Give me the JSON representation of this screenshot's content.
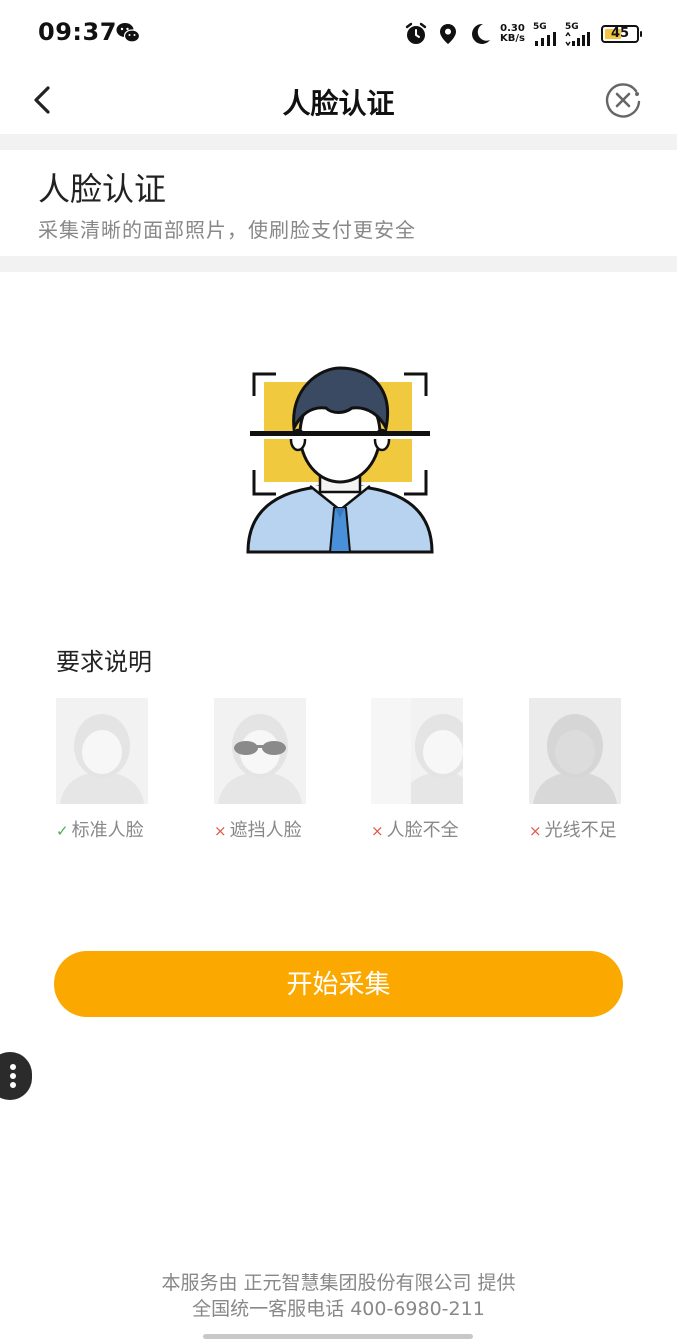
{
  "status_bar": {
    "time": "09:37",
    "speed_value": "0.30",
    "speed_unit": "KB/s",
    "net1": "5G",
    "net2": "5G",
    "battery": "45",
    "icons": [
      "wechat-icon",
      "alarm-icon",
      "location-icon",
      "moon-icon",
      "signal-icon",
      "battery-icon"
    ]
  },
  "header": {
    "title": "人脸认证"
  },
  "intro": {
    "title": "人脸认证",
    "subtitle": "采集清晰的面部照片，使刷脸支付更安全"
  },
  "requirements": {
    "title": "要求说明",
    "items": [
      {
        "label": "标准人脸",
        "ok": true,
        "mark": "✓"
      },
      {
        "label": "遮挡人脸",
        "ok": false,
        "mark": "×"
      },
      {
        "label": "人脸不全",
        "ok": false,
        "mark": "×"
      },
      {
        "label": "光线不足",
        "ok": false,
        "mark": "×"
      }
    ]
  },
  "start_button": "开始采集",
  "footer": {
    "line1": "本服务由 正元智慧集团股份有限公司 提供",
    "line2": "全国统一客服电话 400-6980-211"
  },
  "colors": {
    "accent": "#fba800",
    "frame_yellow": "#f0c93f",
    "hair": "#3a4a63",
    "shirt": "#b7d3f0",
    "tie": "#4a90d9",
    "ok_mark": "#4caf50",
    "no_mark": "#e05a4a"
  }
}
